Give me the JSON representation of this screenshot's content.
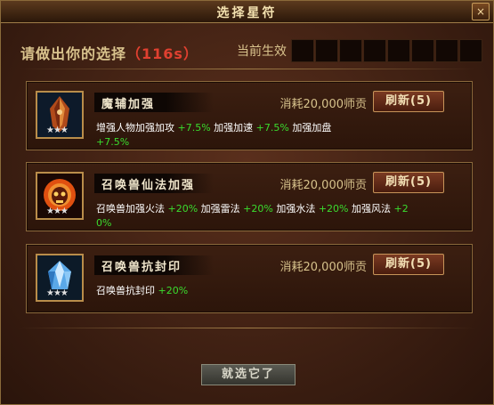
{
  "window": {
    "title": "选择星符",
    "close_label": "×"
  },
  "prompt": {
    "text": "请做出你的选择",
    "countdown": "（116s）"
  },
  "effect": {
    "label": "当前生效"
  },
  "cards": [
    {
      "name": "魔辅加强",
      "cost": "消耗20,000师贡",
      "refresh_label": "刷新(5)",
      "lines": [
        [
          {
            "t": "增强人物加强加攻 "
          },
          {
            "t": "+7.5%",
            "v": true
          },
          {
            "t": " 加强加速 "
          },
          {
            "t": "+7.5%",
            "v": true
          },
          {
            "t": " 加强加盘 "
          },
          {
            "t": "+7.5%",
            "v": true
          }
        ]
      ]
    },
    {
      "name": "召唤兽仙法加强",
      "cost": "消耗20,000师贡",
      "refresh_label": "刷新(5)",
      "lines": [
        [
          {
            "t": "召唤兽加强火法 "
          },
          {
            "t": "+20%",
            "v": true
          },
          {
            "t": " 加强雷法 "
          },
          {
            "t": "+20%",
            "v": true
          },
          {
            "t": " 加强水法 "
          },
          {
            "t": "+20%",
            "v": true
          },
          {
            "t": " 加强风法 "
          },
          {
            "t": "+2",
            "v": true
          }
        ],
        [
          {
            "t": "0%",
            "v": true
          }
        ]
      ]
    },
    {
      "name": "召唤兽抗封印",
      "cost": "消耗20,000师贡",
      "refresh_label": "刷新(5)",
      "lines": [
        [
          {
            "t": "召唤兽抗封印 "
          },
          {
            "t": "+20%",
            "v": true
          }
        ]
      ]
    }
  ],
  "confirm": {
    "label": "就选它了"
  },
  "colors": {
    "value_green": "#3adc2e",
    "countdown_red": "#e04030",
    "gold_text": "#d9c38d"
  }
}
